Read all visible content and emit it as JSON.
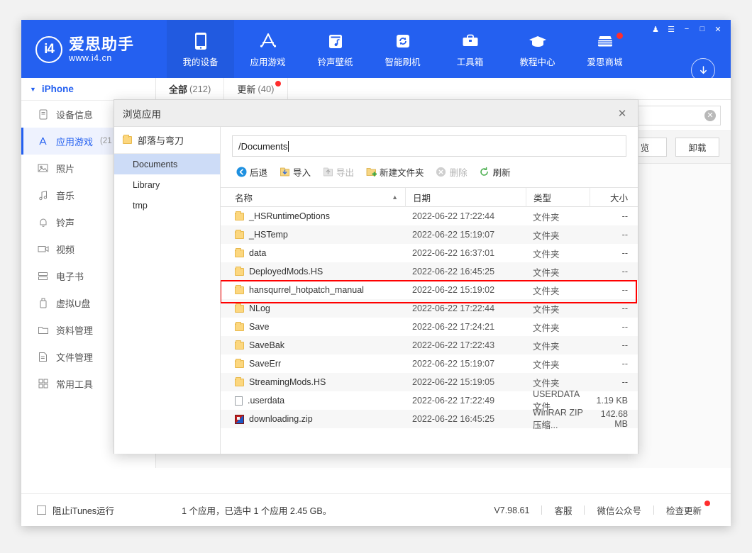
{
  "window": {
    "controls": [
      {
        "name": "skin-icon",
        "glyph": "♟"
      },
      {
        "name": "menu-icon",
        "glyph": "☰"
      },
      {
        "name": "minimize-icon",
        "glyph": "−"
      },
      {
        "name": "maximize-icon",
        "glyph": "□"
      },
      {
        "name": "close-icon",
        "glyph": "✕"
      }
    ]
  },
  "brand": {
    "mark": "i4",
    "name_cn": "爱思助手",
    "url": "www.i4.cn"
  },
  "nav": {
    "items": [
      {
        "label": "我的设备",
        "icon": "phone-icon",
        "active": true,
        "badge": false
      },
      {
        "label": "应用游戏",
        "icon": "appstore-icon",
        "active": false,
        "badge": false
      },
      {
        "label": "铃声壁纸",
        "icon": "ringtone-icon",
        "active": false,
        "badge": false
      },
      {
        "label": "智能刷机",
        "icon": "flash-icon",
        "active": false,
        "badge": false
      },
      {
        "label": "工具箱",
        "icon": "toolbox-icon",
        "active": false,
        "badge": false
      },
      {
        "label": "教程中心",
        "icon": "graduation-icon",
        "active": false,
        "badge": false
      },
      {
        "label": "爱思商城",
        "icon": "shop-icon",
        "active": false,
        "badge": true
      }
    ],
    "download_icon": "download-arrow-icon"
  },
  "sidebar": {
    "device": "iPhone",
    "items": [
      {
        "label": "设备信息",
        "icon": "device-info-icon",
        "count": "",
        "active": false
      },
      {
        "label": "应用游戏",
        "icon": "appstore-icon",
        "count": "(21",
        "active": true
      },
      {
        "label": "照片",
        "icon": "photo-icon",
        "count": "",
        "active": false
      },
      {
        "label": "音乐",
        "icon": "music-icon",
        "count": "",
        "active": false
      },
      {
        "label": "铃声",
        "icon": "bell-icon",
        "count": "",
        "active": false
      },
      {
        "label": "视频",
        "icon": "video-icon",
        "count": "",
        "active": false
      },
      {
        "label": "电子书",
        "icon": "book-icon",
        "count": "",
        "active": false
      },
      {
        "label": "虚拟U盘",
        "icon": "usb-icon",
        "count": "",
        "active": false
      },
      {
        "label": "资料管理",
        "icon": "folder-icon",
        "count": "",
        "active": false
      },
      {
        "label": "文件管理",
        "icon": "document-icon",
        "count": "",
        "active": false
      },
      {
        "label": "常用工具",
        "icon": "grid-icon",
        "count": "",
        "active": false
      }
    ]
  },
  "content": {
    "tabs": [
      {
        "label": "全部",
        "count": "(212)",
        "active": true,
        "badge": false
      },
      {
        "label": "更新",
        "count": "(40)",
        "active": false,
        "badge": true
      }
    ],
    "search_clear_icon": "clear-circle-icon",
    "buttons": [
      {
        "label": "览",
        "name": "browse-button"
      },
      {
        "label": "卸载",
        "name": "uninstall-button"
      }
    ]
  },
  "dialog": {
    "title": "浏览应用",
    "close_icon": "close-icon",
    "app_name": "部落与弯刀",
    "tree": [
      {
        "label": "Documents",
        "active": true
      },
      {
        "label": "Library",
        "active": false
      },
      {
        "label": "tmp",
        "active": false
      }
    ],
    "path": "/Documents",
    "toolbar": [
      {
        "label": "后退",
        "icon": "back-icon",
        "disabled": false
      },
      {
        "label": "导入",
        "icon": "import-icon",
        "disabled": false
      },
      {
        "label": "导出",
        "icon": "export-icon",
        "disabled": true
      },
      {
        "label": "新建文件夹",
        "icon": "new-folder-icon",
        "disabled": false
      },
      {
        "label": "删除",
        "icon": "delete-icon",
        "disabled": true
      },
      {
        "label": "刷新",
        "icon": "refresh-icon",
        "disabled": false
      }
    ],
    "columns": [
      "名称",
      "日期",
      "类型",
      "大小"
    ],
    "sort_caret": "▲",
    "rows": [
      {
        "name": "_HSRuntimeOptions",
        "date": "2022-06-22 17:22:44",
        "type": "文件夹",
        "size": "--",
        "icon": "folder-icon",
        "highlight": false
      },
      {
        "name": "_HSTemp",
        "date": "2022-06-22 15:19:07",
        "type": "文件夹",
        "size": "--",
        "icon": "folder-icon",
        "highlight": false
      },
      {
        "name": "data",
        "date": "2022-06-22 16:37:01",
        "type": "文件夹",
        "size": "--",
        "icon": "folder-icon",
        "highlight": false
      },
      {
        "name": "DeployedMods.HS",
        "date": "2022-06-22 16:45:25",
        "type": "文件夹",
        "size": "--",
        "icon": "folder-icon",
        "highlight": true
      },
      {
        "name": "hansqurrel_hotpatch_manual",
        "date": "2022-06-22 15:19:02",
        "type": "文件夹",
        "size": "--",
        "icon": "folder-icon",
        "highlight": false
      },
      {
        "name": "NLog",
        "date": "2022-06-22 17:22:44",
        "type": "文件夹",
        "size": "--",
        "icon": "folder-icon",
        "highlight": false
      },
      {
        "name": "Save",
        "date": "2022-06-22 17:24:21",
        "type": "文件夹",
        "size": "--",
        "icon": "folder-icon",
        "highlight": false
      },
      {
        "name": "SaveBak",
        "date": "2022-06-22 17:22:43",
        "type": "文件夹",
        "size": "--",
        "icon": "folder-icon",
        "highlight": false
      },
      {
        "name": "SaveErr",
        "date": "2022-06-22 15:19:07",
        "type": "文件夹",
        "size": "--",
        "icon": "folder-icon",
        "highlight": false
      },
      {
        "name": "StreamingMods.HS",
        "date": "2022-06-22 15:19:05",
        "type": "文件夹",
        "size": "--",
        "icon": "folder-icon",
        "highlight": false
      },
      {
        "name": ".userdata",
        "date": "2022-06-22 17:22:49",
        "type": "USERDATA 文件",
        "size": "1.19 KB",
        "icon": "file-icon",
        "highlight": false
      },
      {
        "name": "downloading.zip",
        "date": "2022-06-22 16:45:25",
        "type": "WinRAR ZIP 压缩...",
        "size": "142.68 MB",
        "icon": "zip-icon",
        "highlight": false
      }
    ]
  },
  "statusbar": {
    "checkbox_label": "阻止iTunes运行",
    "selection": "1 个应用，已选中 1 个应用 2.45 GB。",
    "version": "V7.98.61",
    "links": [
      "客服",
      "微信公众号",
      "检查更新"
    ]
  },
  "colors": {
    "brand_blue": "#2460f0",
    "nav_active": "#215ae0",
    "highlight_red": "#ff0000",
    "badge_red": "#ff2d2d",
    "tree_selected": "#cddcf7"
  }
}
